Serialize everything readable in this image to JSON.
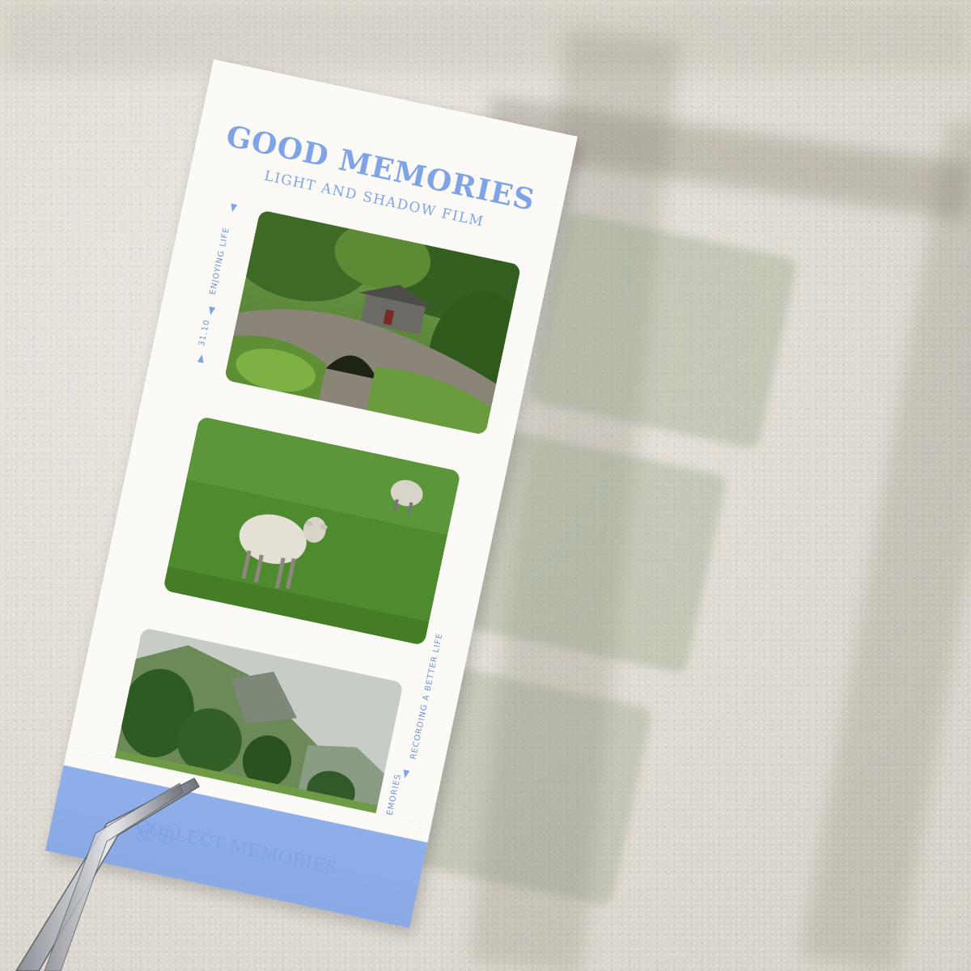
{
  "card": {
    "title": "GOOD MEMORIES",
    "subtitle": "LIGHT AND SHADOW FILM",
    "side_left_top": "ENJOYING LIFE",
    "side_left_mid": "31.10",
    "side_right_mid": "RECORDING A BETTER LIFE",
    "side_right_bottom": "COLLECT MEMORIES",
    "footer": "COLLECT MEMORIES",
    "icon": "film-reel-icon"
  },
  "photos": [
    {
      "subject": "stone-bridge-and-barn-photo"
    },
    {
      "subject": "sheep-in-field-photo"
    },
    {
      "subject": "valley-with-grazing-sheep-photo"
    }
  ],
  "colors": {
    "accent": "#7fa4e6",
    "band": "#8fb0ec",
    "paper": "#fbfaf7",
    "background": "#e1ddd5"
  }
}
